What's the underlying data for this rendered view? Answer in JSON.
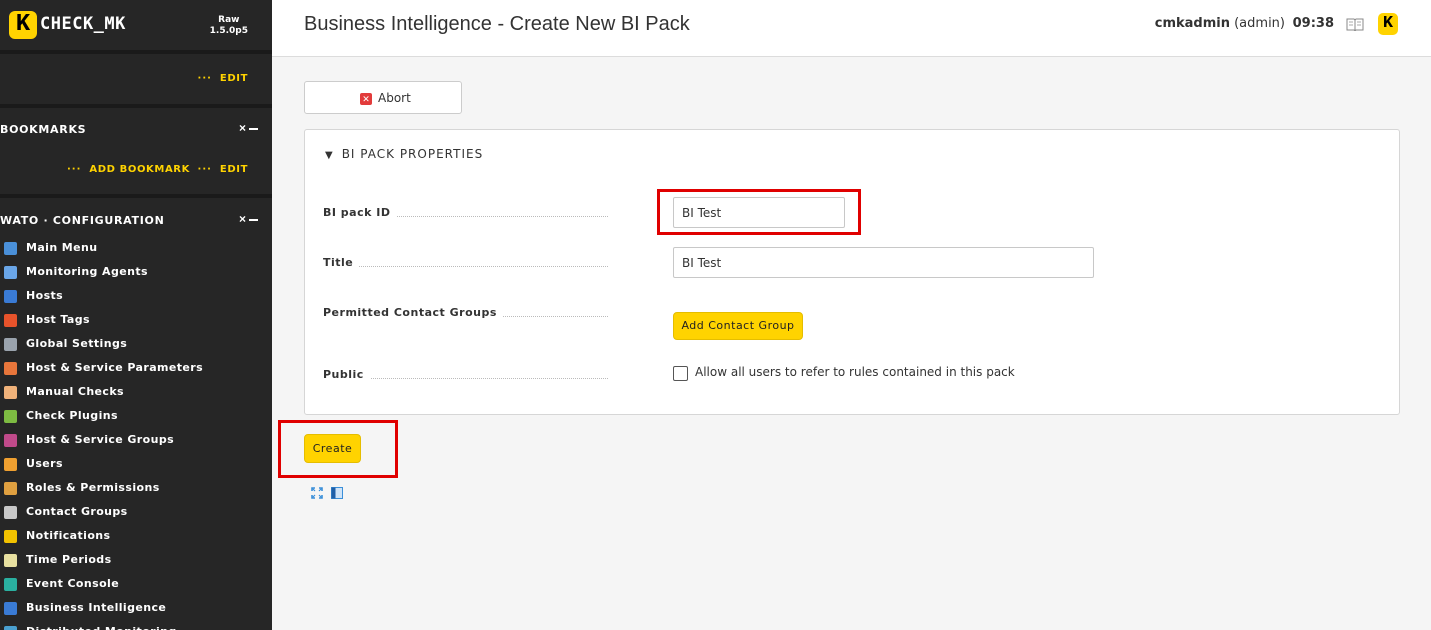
{
  "sidebar": {
    "logo_letter": "K",
    "logo_text": "CHECK_MK",
    "edition": "Raw",
    "version": "1.5.0p5",
    "top_edit": "EDIT",
    "bookmarks": {
      "title": "BOOKMARKS",
      "close": "×",
      "minimize": "—",
      "add_bookmark": "ADD BOOKMARK",
      "edit": "EDIT"
    },
    "wato": {
      "title": "WATO · CONFIGURATION",
      "close": "×",
      "minimize": "—",
      "items": [
        {
          "label": "Main Menu",
          "icon": "home-icon",
          "color": "#4a90d9"
        },
        {
          "label": "Monitoring Agents",
          "icon": "agent-icon",
          "color": "#6aa6e8"
        },
        {
          "label": "Hosts",
          "icon": "host-icon",
          "color": "#3a7bd5"
        },
        {
          "label": "Host Tags",
          "icon": "tag-icon",
          "color": "#e8532b"
        },
        {
          "label": "Global Settings",
          "icon": "gear-icon",
          "color": "#9aa3ad"
        },
        {
          "label": "Host & Service Parameters",
          "icon": "rulesets-icon",
          "color": "#e8763b"
        },
        {
          "label": "Manual Checks",
          "icon": "hand-icon",
          "color": "#f0b27a"
        },
        {
          "label": "Check Plugins",
          "icon": "puzzle-icon",
          "color": "#7dbb42"
        },
        {
          "label": "Host & Service Groups",
          "icon": "groups-icon",
          "color": "#c04a8a"
        },
        {
          "label": "Users",
          "icon": "users-icon",
          "color": "#f0a030"
        },
        {
          "label": "Roles & Permissions",
          "icon": "roles-icon",
          "color": "#e0a040"
        },
        {
          "label": "Contact Groups",
          "icon": "contactgroups-icon",
          "color": "#c8c8c8"
        },
        {
          "label": "Notifications",
          "icon": "bell-icon",
          "color": "#f2c200"
        },
        {
          "label": "Time Periods",
          "icon": "clock-icon",
          "color": "#e8e0a0"
        },
        {
          "label": "Event Console",
          "icon": "event-console-icon",
          "color": "#2ab0a0"
        },
        {
          "label": "Business Intelligence",
          "icon": "bi-icon",
          "color": "#3a7bd5"
        },
        {
          "label": "Distributed Monitoring",
          "icon": "distributed-icon",
          "color": "#4aa0d0"
        }
      ]
    }
  },
  "header": {
    "title": "Business Intelligence - Create New BI Pack",
    "username": "cmkadmin",
    "role": "(admin)",
    "time": "09:38",
    "logo_letter": "K"
  },
  "abort_button": {
    "label": "Abort",
    "icon": "close-icon"
  },
  "form": {
    "section_title": "BI PACK PROPERTIES",
    "fields": {
      "pack_id": {
        "label": "BI pack ID",
        "value": "BI Test"
      },
      "title": {
        "label": "Title",
        "value": "BI Test"
      },
      "contact_groups": {
        "label": "Permitted Contact Groups",
        "button": "Add Contact Group"
      },
      "public": {
        "label": "Public",
        "checkbox_label": "Allow all users to refer to rules contained in this pack",
        "checked": false
      }
    }
  },
  "create_button": {
    "label": "Create"
  },
  "colors": {
    "accent_yellow": "#ffd300",
    "sidebar_bg": "#262626",
    "highlight_red": "#e00000"
  }
}
